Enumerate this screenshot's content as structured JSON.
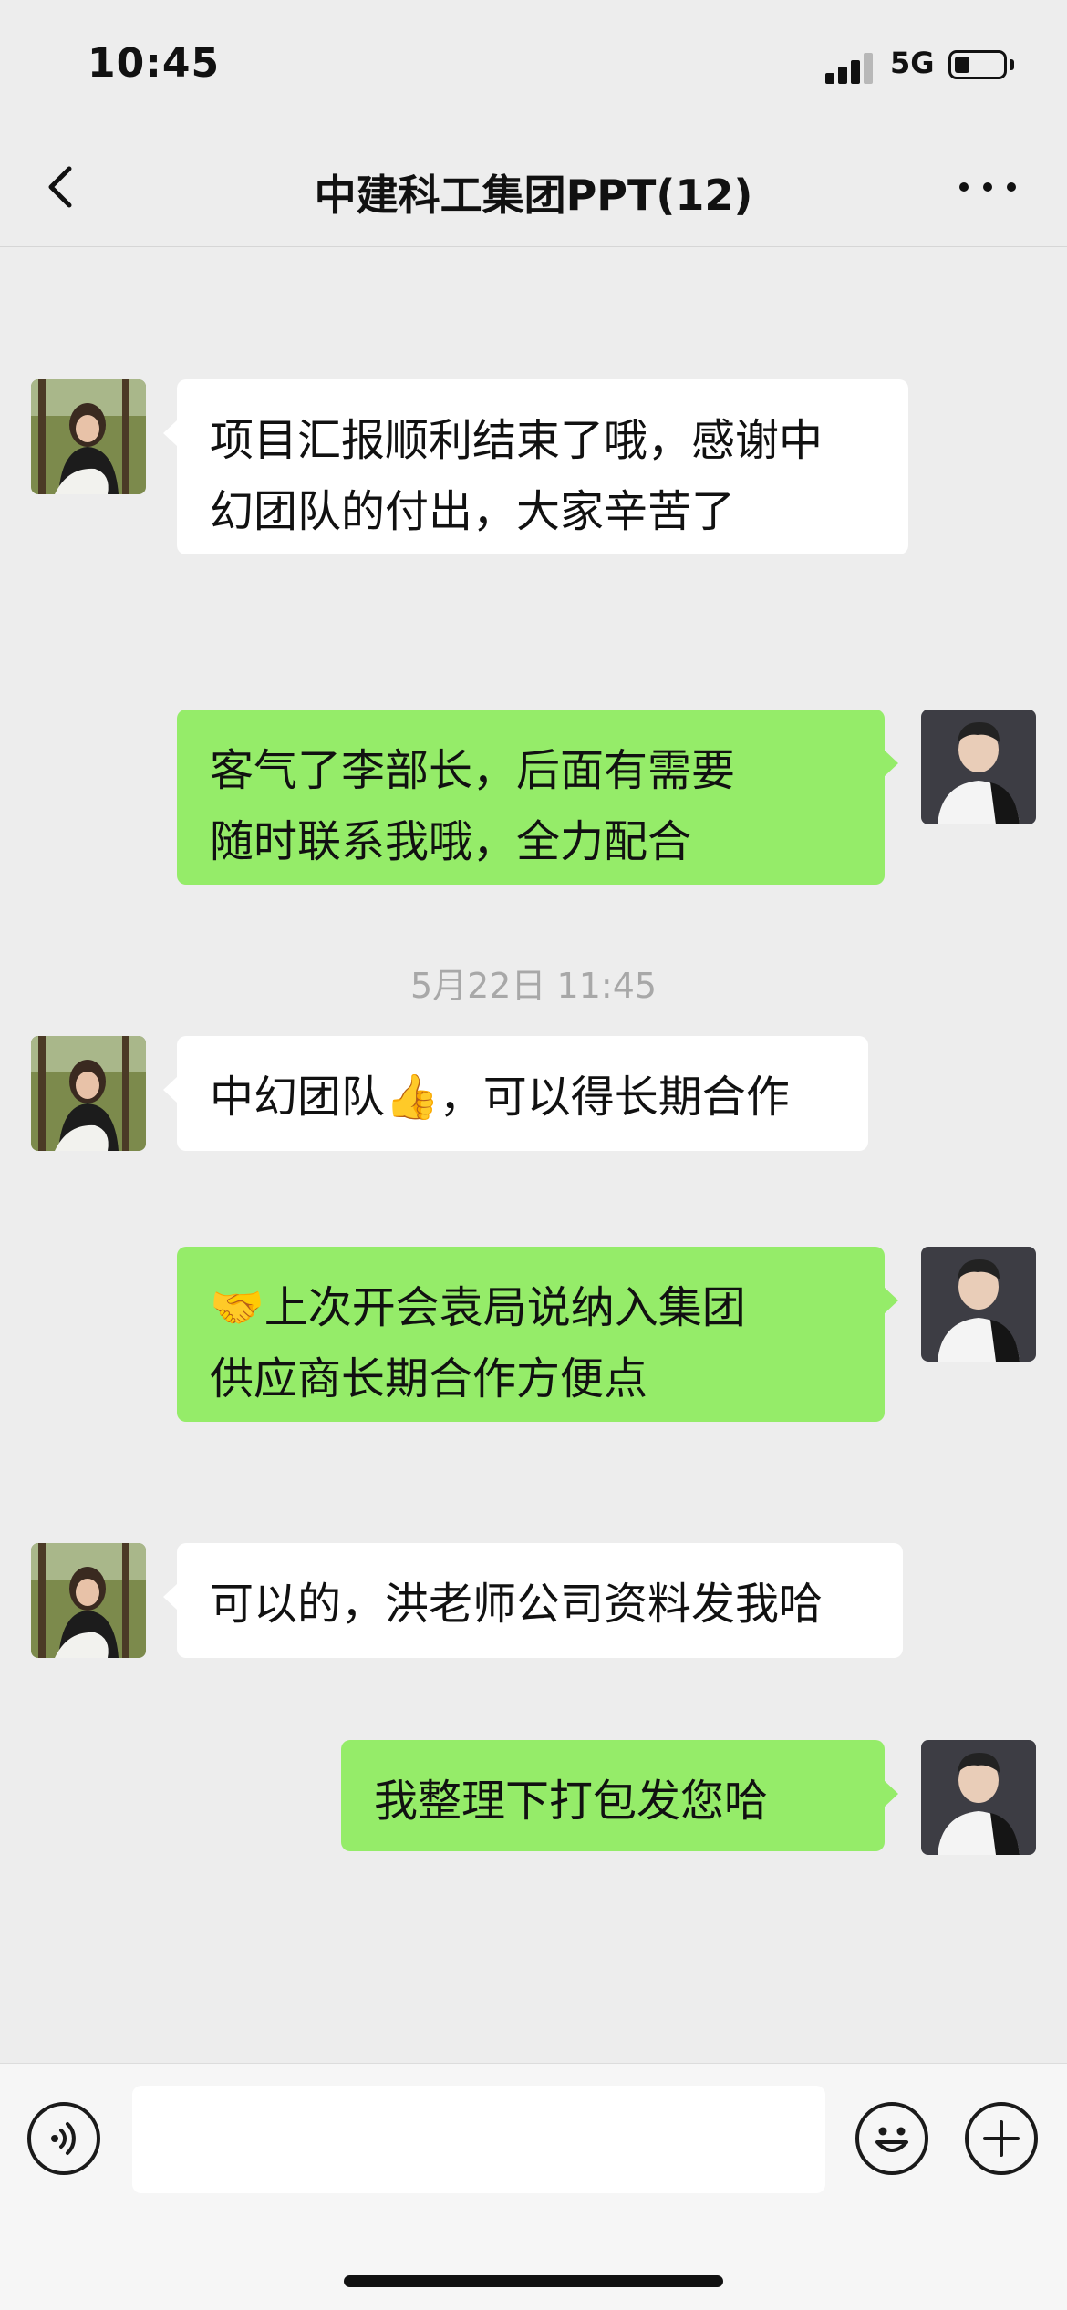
{
  "status_bar": {
    "time": "10:45",
    "network": "5G",
    "battery_level": 0.3,
    "signal_bars": 3
  },
  "nav": {
    "title": "中建科工集团PPT(12)",
    "back_icon": "chevron-left-icon",
    "more_icon": "more-dots-icon"
  },
  "messages": [
    {
      "side": "in",
      "text": "项目汇报顺利结束了哦，感谢中\n幻团队的付出，大家辛苦了"
    },
    {
      "side": "out",
      "text": "客气了李部长，后面有需要\n随时联系我哦，全力配合"
    },
    {
      "side": "in",
      "text": "中幻团队👍，可以得长期合作"
    },
    {
      "side": "out",
      "text": "🤝上次开会袁局说纳入集团\n供应商长期合作方便点"
    },
    {
      "side": "in",
      "text": "可以的，洪老师公司资料发我哈"
    },
    {
      "side": "out",
      "text": "我整理下打包发您哈"
    }
  ],
  "timestamp": "5月22日 11:45",
  "input_bar": {
    "message_value": "",
    "voice_icon": "voice-icon",
    "emoji_icon": "emoji-smile-icon",
    "plus_icon": "plus-icon"
  },
  "colors": {
    "background": "#ededed",
    "outgoing_bubble": "#95ec69",
    "incoming_bubble": "#ffffff"
  }
}
